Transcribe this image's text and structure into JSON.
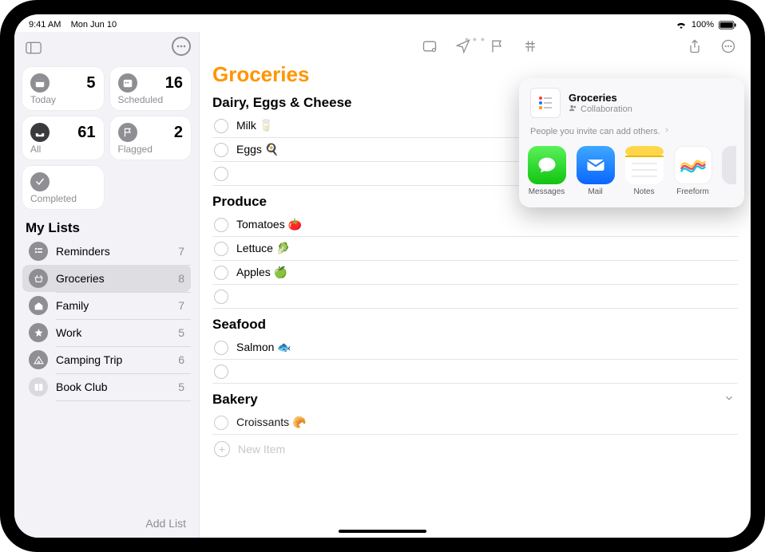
{
  "status": {
    "time": "9:41 AM",
    "date": "Mon Jun 10",
    "battery_pct": "100%"
  },
  "sidebar": {
    "cards": {
      "today": {
        "label": "Today",
        "count": 5
      },
      "scheduled": {
        "label": "Scheduled",
        "count": 16
      },
      "all": {
        "label": "All",
        "count": 61
      },
      "flagged": {
        "label": "Flagged",
        "count": 2
      },
      "completed": {
        "label": "Completed"
      }
    },
    "mylists_header": "My Lists",
    "lists": [
      {
        "label": "Reminders",
        "count": 7
      },
      {
        "label": "Groceries",
        "count": 8
      },
      {
        "label": "Family",
        "count": 7
      },
      {
        "label": "Work",
        "count": 5
      },
      {
        "label": "Camping Trip",
        "count": 6
      },
      {
        "label": "Book Club",
        "count": 5
      }
    ],
    "add_list": "Add List"
  },
  "main": {
    "title": "Groceries",
    "new_item": "New Item",
    "sections": [
      {
        "title": "Dairy, Eggs & Cheese",
        "items": [
          "Milk 🥛",
          "Eggs 🍳"
        ]
      },
      {
        "title": "Produce",
        "items": [
          "Tomatoes 🍅",
          "Lettuce 🥬",
          "Apples 🍏"
        ]
      },
      {
        "title": "Seafood",
        "items": [
          "Salmon 🐟"
        ]
      },
      {
        "title": "Bakery",
        "items": [
          "Croissants 🥐"
        ],
        "collapsible": true
      }
    ]
  },
  "share": {
    "title": "Groceries",
    "subtitle": "Collaboration",
    "note": "People you invite can add others.",
    "apps": [
      {
        "label": "Messages"
      },
      {
        "label": "Mail"
      },
      {
        "label": "Notes"
      },
      {
        "label": "Freeform"
      }
    ]
  }
}
